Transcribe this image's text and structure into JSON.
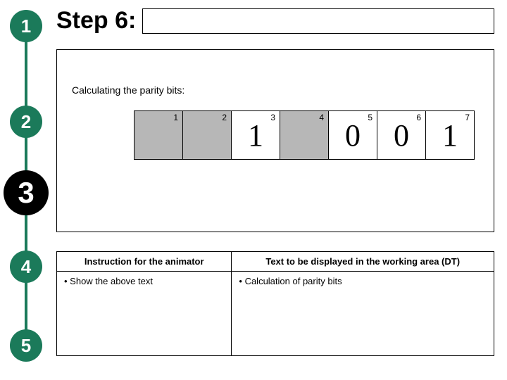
{
  "header": {
    "step_label": "Step 6:"
  },
  "rail": {
    "steps": [
      "1",
      "2",
      "3",
      "4",
      "5"
    ],
    "active_index": 2
  },
  "work": {
    "caption": "Calculating the parity bits:"
  },
  "bits": [
    {
      "index": "1",
      "value": "",
      "shaded": true
    },
    {
      "index": "2",
      "value": "",
      "shaded": true
    },
    {
      "index": "3",
      "value": "1",
      "shaded": false
    },
    {
      "index": "4",
      "value": "",
      "shaded": true
    },
    {
      "index": "5",
      "value": "0",
      "shaded": false
    },
    {
      "index": "6",
      "value": "0",
      "shaded": false
    },
    {
      "index": "7",
      "value": "1",
      "shaded": false
    }
  ],
  "table": {
    "headers": [
      "Instruction for the animator",
      "Text to be displayed in the working area (DT)"
    ],
    "left_items": [
      "Show the above text"
    ],
    "right_items": [
      "Calculation of parity bits"
    ]
  },
  "colors": {
    "rail": "#1b7a5a",
    "marker_active": "#000000",
    "shaded_cell": "#b7b7b7"
  }
}
